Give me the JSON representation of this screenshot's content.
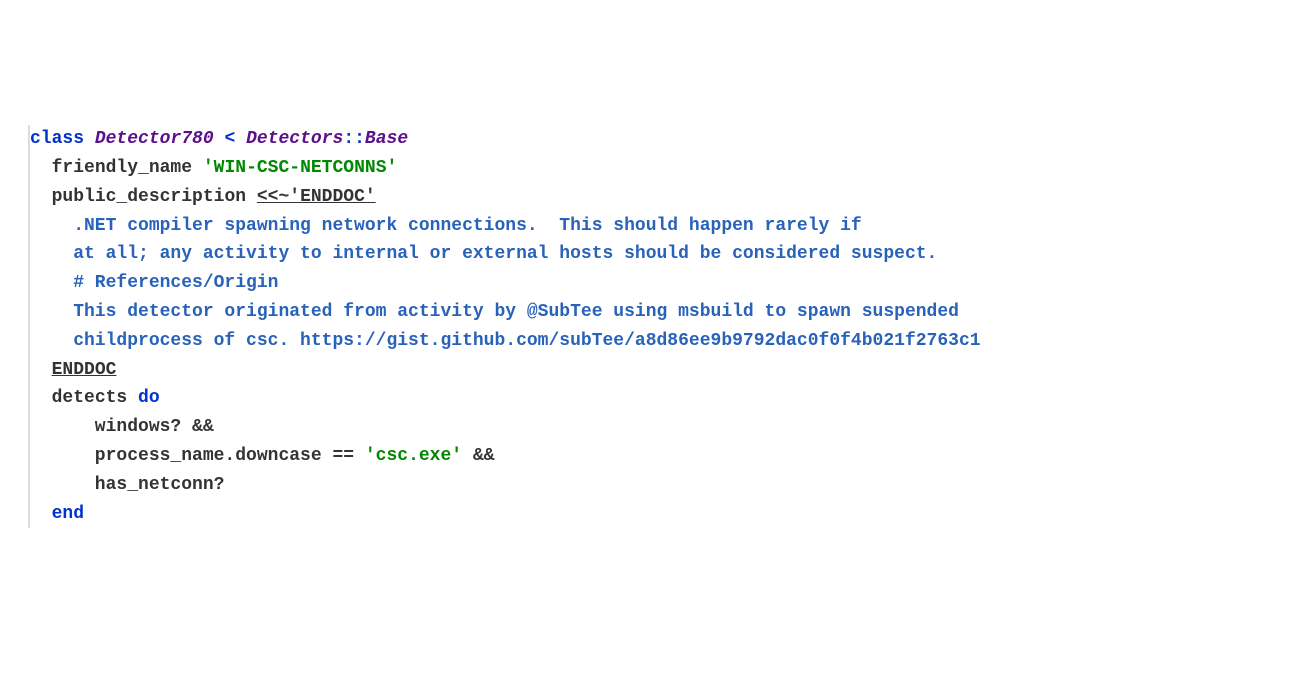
{
  "code": {
    "line1": {
      "class_kw": "class",
      "class_name": "Detector780",
      "lt": "<",
      "module": "Detectors",
      "sep": "::",
      "base": "Base"
    },
    "line2": {
      "indent": "  ",
      "method": "friendly_name",
      "space": " ",
      "string": "'WIN-CSC-NETCONNS'"
    },
    "line3": "",
    "line4": {
      "indent": "  ",
      "method": "public_description",
      "space": " ",
      "heredoc": "<<~'ENDDOC'"
    },
    "body1": "    .NET compiler spawning network connections.  This should happen rarely if",
    "body2": "    at all; any activity to internal or external hosts should be considered suspect.",
    "body3": "",
    "body4": "    # References/Origin",
    "body5": "    This detector originated from activity by @SubTee using msbuild to spawn suspended",
    "body6": "    childprocess of csc. https://gist.github.com/subTee/a8d86ee9b9792dac0f0f4b021f2763c1",
    "line_enddoc": {
      "indent": "  ",
      "text": "ENDDOC"
    },
    "line_blank2": "",
    "line_detects": {
      "indent": "  ",
      "method": "detects",
      "space": " ",
      "do_kw": "do"
    },
    "d1a": "      windows? &&",
    "d2a": "      process_name.downcase == ",
    "d2b": "'csc.exe'",
    "d2c": " &&",
    "d3a": "      has_netconn?",
    "line_end": {
      "indent": "  ",
      "end_kw": "end"
    }
  }
}
